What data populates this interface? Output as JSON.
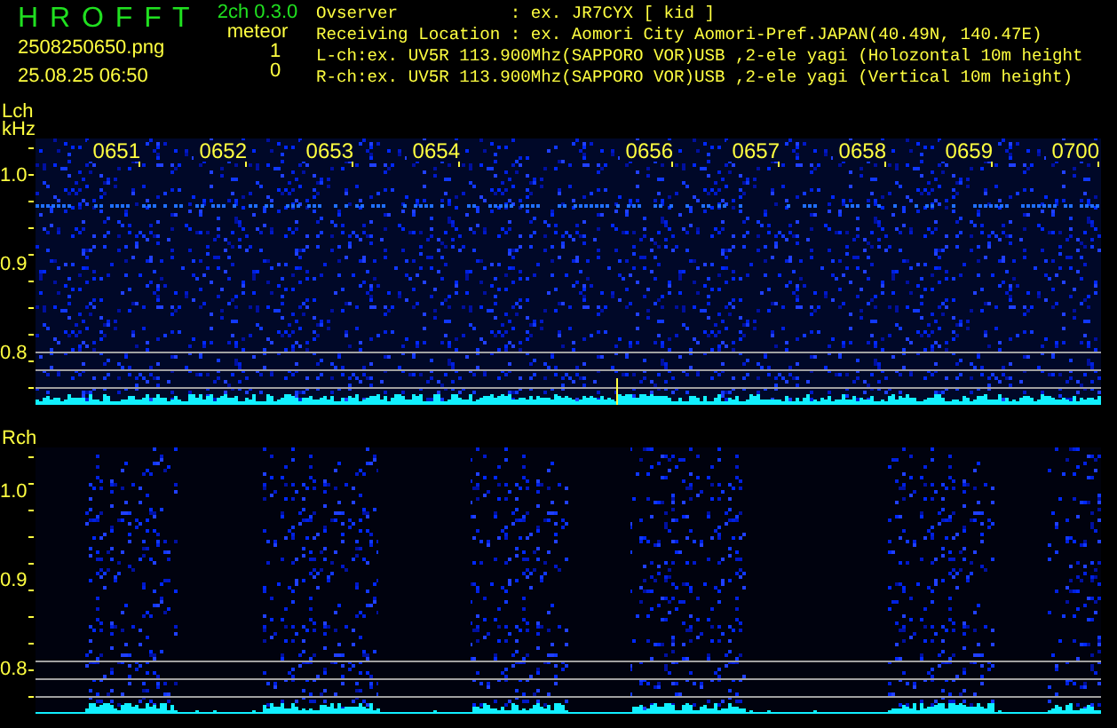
{
  "header": {
    "app_title": "H R O F F T",
    "version": "2ch 0.3.0",
    "filename": "2508250650.png",
    "datetime": "25.08.25 06:50",
    "mode": "meteor",
    "counts": [
      "1",
      "0"
    ],
    "info_lines": [
      "Ovserver           : ex. JR7CYX [ kid ]",
      "Receiving Location : ex. Aomori City Aomori-Pref.JAPAN(40.49N, 140.47E)",
      "L-ch:ex. UV5R 113.900Mhz(SAPPORO VOR)USB ,2-ele yagi (Holozontal 10m height",
      "R-ch:ex. UV5R 113.900Mhz(SAPPORO VOR)USB ,2-ele yagi (Vertical 10m height)"
    ]
  },
  "panels": [
    {
      "label": "Lch",
      "unit": "kHz",
      "kind": "continuous",
      "y_labels": [
        "1.0",
        "0.9",
        "0.8"
      ],
      "time_ticks": [
        {
          "kind": "tick",
          "label": "0651"
        },
        {
          "kind": "tick",
          "label": "0652"
        },
        {
          "kind": "tick",
          "label": "0653"
        },
        {
          "kind": "tick",
          "label": "0654"
        },
        {
          "kind": "gap"
        },
        {
          "kind": "tick",
          "label": "0656"
        },
        {
          "kind": "tick",
          "label": "0657"
        },
        {
          "kind": "tick",
          "label": "0658"
        },
        {
          "kind": "tick",
          "label": "0659"
        },
        {
          "kind": "tick",
          "label": "0700"
        }
      ]
    },
    {
      "label": "Rch",
      "kind": "banded",
      "y_labels": [
        "1.0",
        "0.9",
        "0.8"
      ]
    }
  ]
}
